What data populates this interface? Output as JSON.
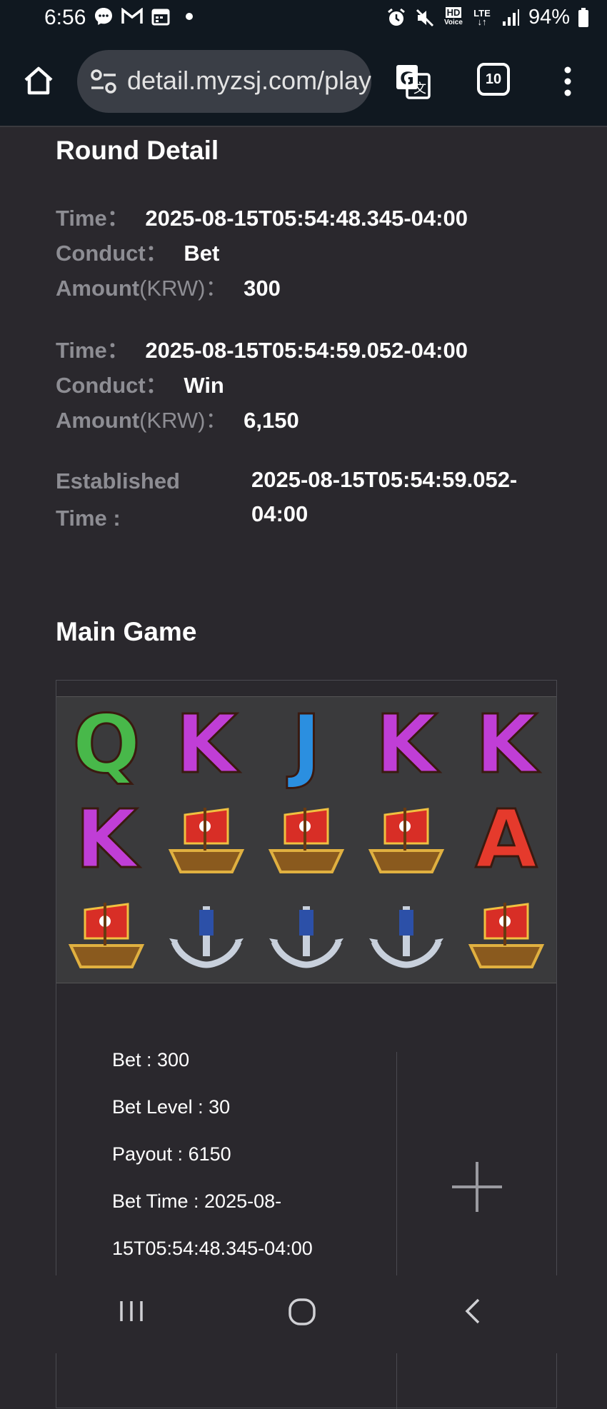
{
  "status_bar": {
    "time": "6:56",
    "battery": "94%",
    "network": "LTE",
    "hd_label": "HD",
    "voice_label": "Voice"
  },
  "browser": {
    "url": "detail.myzsj.com/play",
    "tab_count": "10"
  },
  "round_detail": {
    "title": "Round Detail",
    "records": [
      {
        "time_label": "Time：",
        "time_value": "2025-08-15T05:54:48.345-04:00",
        "conduct_label": "Conduct：",
        "conduct_value": "Bet",
        "amount_label": "Amount",
        "amount_unit": "(KRW)：",
        "amount_value": "300"
      },
      {
        "time_label": "Time：",
        "time_value": "2025-08-15T05:54:59.052-04:00",
        "conduct_label": "Conduct：",
        "conduct_value": "Win",
        "amount_label": "Amount",
        "amount_unit": "(KRW)：",
        "amount_value": "6,150"
      }
    ],
    "established_label_1": "Established",
    "established_label_2": "Time :",
    "established_value_1": "2025-08-15T05:54:59.052-",
    "established_value_2": "04:00"
  },
  "main_game": {
    "title": "Main Game",
    "reels": [
      [
        "Q",
        "K",
        "J",
        "K",
        "K"
      ],
      [
        "K",
        "pirate-ship",
        "pirate-ship",
        "pirate-ship",
        "A"
      ],
      [
        "pirate-ship",
        "anchor",
        "anchor",
        "anchor",
        "pirate-ship"
      ]
    ],
    "symbols": {
      "Q": "Q",
      "K": "K",
      "J": "J",
      "A": "A"
    },
    "details": {
      "bet": "Bet : 300",
      "bet_level": "Bet Level : 30",
      "payout": "Payout : 6150",
      "bet_time_1": "Bet Time : 2025-08-",
      "bet_time_2": "15T05:54:48.345-04:00"
    }
  },
  "colors": {
    "background": "#2a282d",
    "label_gray": "#8d8d93",
    "q_green": "#48b84a",
    "k_purple": "#c03ed6",
    "j_blue": "#2b8fe0",
    "a_red": "#e53a2c"
  }
}
